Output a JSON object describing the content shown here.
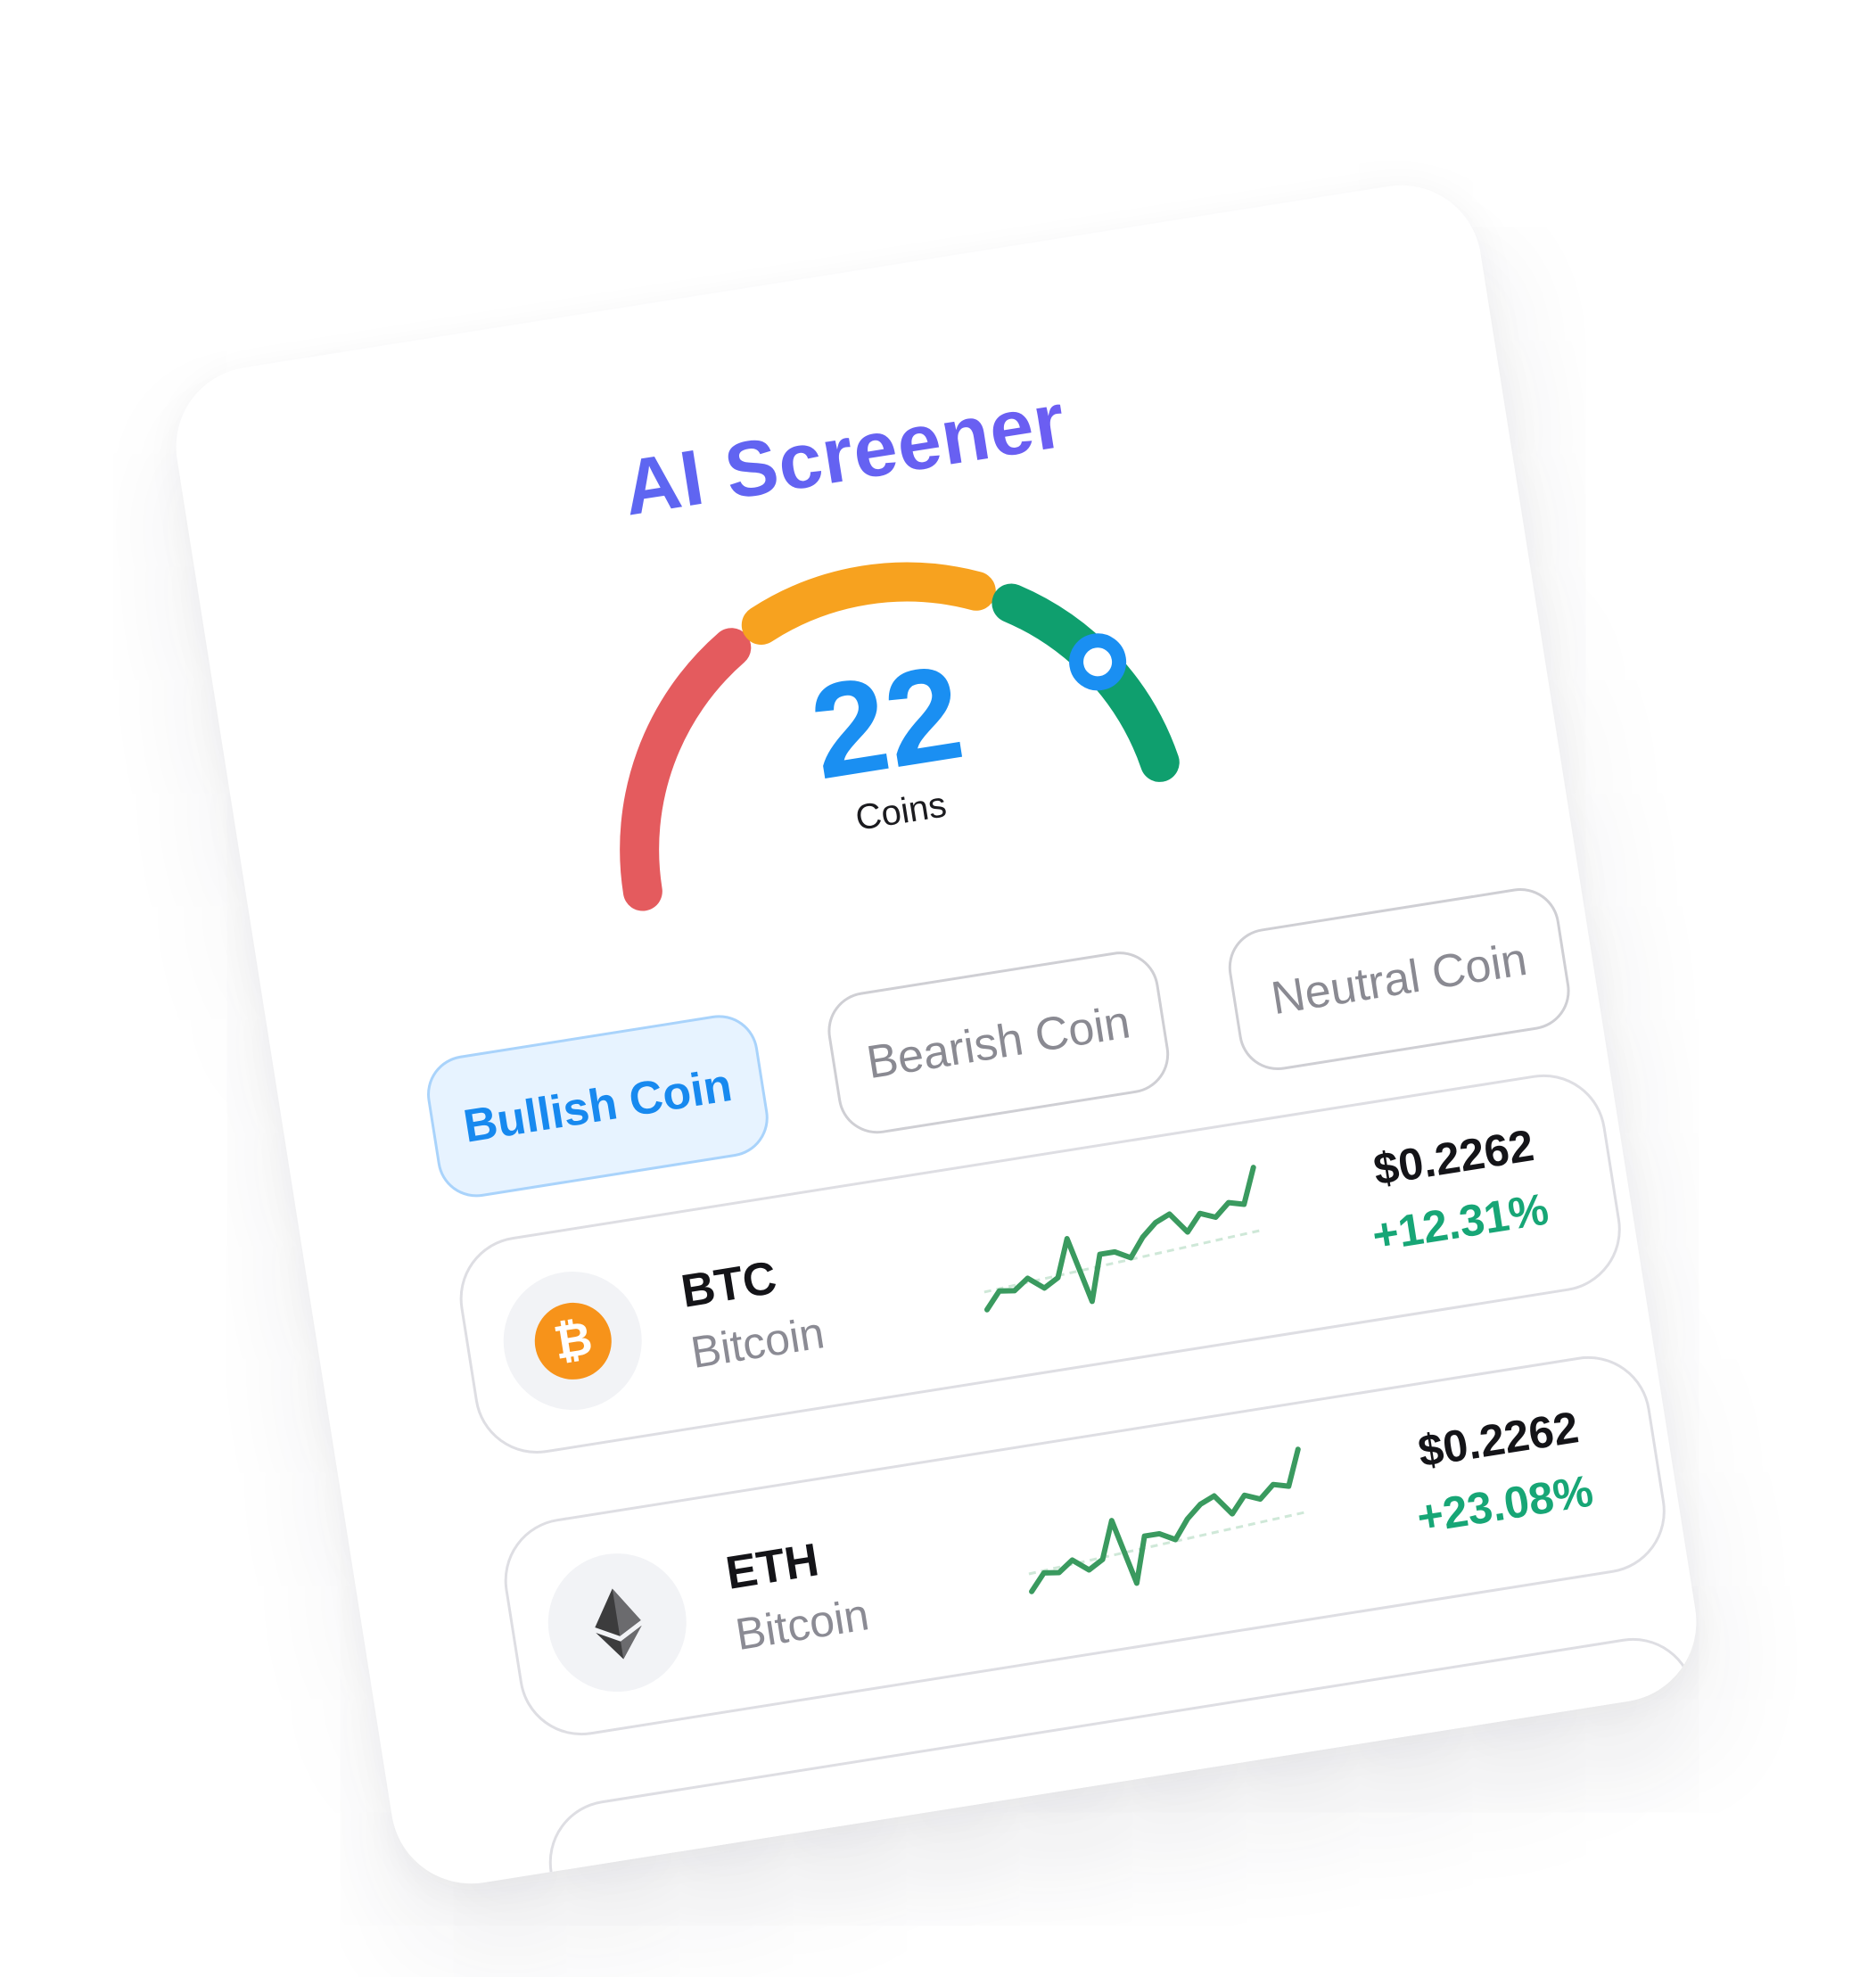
{
  "screen": {
    "title": "AI Screener",
    "gauge": {
      "value": "22",
      "caption": "Coins",
      "indicator_level": 0.85,
      "segments": [
        {
          "name": "bearish",
          "color": "#e45b5e"
        },
        {
          "name": "neutral",
          "color": "#f7a21f"
        },
        {
          "name": "bullish",
          "color": "#0f9f6e"
        }
      ],
      "indicator_color": "#1a8ff2"
    },
    "tabs": [
      {
        "label": "Bullish Coin",
        "active": true
      },
      {
        "label": "Bearish Coin",
        "active": false
      },
      {
        "label": "Neutral Coin",
        "active": false
      }
    ],
    "coins": [
      {
        "symbol": "BTC",
        "name": "Bitcoin",
        "price": "$0.2262",
        "change": "+12.31%",
        "icon": "bitcoin-icon",
        "icon_color": "#f7931a",
        "sparkline": [
          12,
          20,
          19,
          24,
          18,
          22,
          40,
          8,
          30,
          30,
          26,
          35,
          41,
          44,
          34,
          42,
          39,
          45,
          43,
          60
        ]
      },
      {
        "symbol": "ETH",
        "name": "Bitcoin",
        "price": "$0.2262",
        "change": "+23.08%",
        "icon": "ethereum-icon",
        "icon_color": "#3c3c3d",
        "sparkline": [
          12,
          20,
          19,
          24,
          18,
          22,
          40,
          8,
          30,
          30,
          26,
          35,
          41,
          44,
          34,
          42,
          39,
          45,
          43,
          60
        ]
      }
    ],
    "accent_green": "#17a676",
    "sparkline_color": "#3a9a5f"
  }
}
